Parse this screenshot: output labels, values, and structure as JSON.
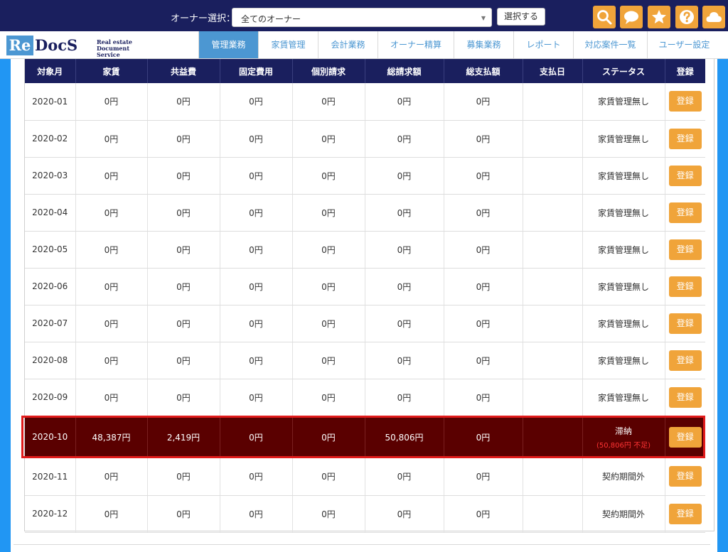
{
  "header": {
    "owner_label": "オーナー選択：",
    "owner_value": "全てのオーナー",
    "select_button": "選択する"
  },
  "logo": {
    "re": "Re",
    "docs": "DocS",
    "tag_line1": "Real estate",
    "tag_line2": "Document Service"
  },
  "nav": [
    {
      "label": "管理業務",
      "active": true
    },
    {
      "label": "家賃管理"
    },
    {
      "label": "会計業務"
    },
    {
      "label": "オーナー精算"
    },
    {
      "label": "募集業務"
    },
    {
      "label": "レポート"
    },
    {
      "label": "対応案件一覧"
    },
    {
      "label": "ユーザー設定"
    }
  ],
  "icons": [
    "search-icon",
    "chat-icon",
    "star-icon",
    "help-icon",
    "cloud-icon"
  ],
  "colors": {
    "header_bg": "#1a1f5e",
    "accent": "#4c97d2",
    "button": "#f0a43a",
    "highlight_bg": "#5a0000",
    "highlight_border": "#e11b1b"
  },
  "table": {
    "columns": [
      "対象月",
      "家賃",
      "共益費",
      "固定費用",
      "個別請求",
      "総請求額",
      "総支払額",
      "支払日",
      "ステータス",
      "登録"
    ],
    "rows": [
      {
        "month": "2020-01",
        "rent": "0円",
        "common": "0円",
        "fixed": "0円",
        "individual": "0円",
        "total_billed": "0円",
        "total_paid": "0円",
        "pay_date": "",
        "status": "家賃管理無し",
        "note": "",
        "button": "登録"
      },
      {
        "month": "2020-02",
        "rent": "0円",
        "common": "0円",
        "fixed": "0円",
        "individual": "0円",
        "total_billed": "0円",
        "total_paid": "0円",
        "pay_date": "",
        "status": "家賃管理無し",
        "note": "",
        "button": "登録"
      },
      {
        "month": "2020-03",
        "rent": "0円",
        "common": "0円",
        "fixed": "0円",
        "individual": "0円",
        "total_billed": "0円",
        "total_paid": "0円",
        "pay_date": "",
        "status": "家賃管理無し",
        "note": "",
        "button": "登録"
      },
      {
        "month": "2020-04",
        "rent": "0円",
        "common": "0円",
        "fixed": "0円",
        "individual": "0円",
        "total_billed": "0円",
        "total_paid": "0円",
        "pay_date": "",
        "status": "家賃管理無し",
        "note": "",
        "button": "登録"
      },
      {
        "month": "2020-05",
        "rent": "0円",
        "common": "0円",
        "fixed": "0円",
        "individual": "0円",
        "total_billed": "0円",
        "total_paid": "0円",
        "pay_date": "",
        "status": "家賃管理無し",
        "note": "",
        "button": "登録"
      },
      {
        "month": "2020-06",
        "rent": "0円",
        "common": "0円",
        "fixed": "0円",
        "individual": "0円",
        "total_billed": "0円",
        "total_paid": "0円",
        "pay_date": "",
        "status": "家賃管理無し",
        "note": "",
        "button": "登録"
      },
      {
        "month": "2020-07",
        "rent": "0円",
        "common": "0円",
        "fixed": "0円",
        "individual": "0円",
        "total_billed": "0円",
        "total_paid": "0円",
        "pay_date": "",
        "status": "家賃管理無し",
        "note": "",
        "button": "登録"
      },
      {
        "month": "2020-08",
        "rent": "0円",
        "common": "0円",
        "fixed": "0円",
        "individual": "0円",
        "total_billed": "0円",
        "total_paid": "0円",
        "pay_date": "",
        "status": "家賃管理無し",
        "note": "",
        "button": "登録"
      },
      {
        "month": "2020-09",
        "rent": "0円",
        "common": "0円",
        "fixed": "0円",
        "individual": "0円",
        "total_billed": "0円",
        "total_paid": "0円",
        "pay_date": "",
        "status": "家賃管理無し",
        "note": "",
        "button": "登録"
      },
      {
        "month": "2020-10",
        "rent": "48,387円",
        "common": "2,419円",
        "fixed": "0円",
        "individual": "0円",
        "total_billed": "50,806円",
        "total_paid": "0円",
        "pay_date": "",
        "status": "滞納",
        "note": "(50,806円 不足)",
        "button": "登録",
        "highlight": true
      },
      {
        "month": "2020-11",
        "rent": "0円",
        "common": "0円",
        "fixed": "0円",
        "individual": "0円",
        "total_billed": "0円",
        "total_paid": "0円",
        "pay_date": "",
        "status": "契約期間外",
        "note": "",
        "button": "登録"
      },
      {
        "month": "2020-12",
        "rent": "0円",
        "common": "0円",
        "fixed": "0円",
        "individual": "0円",
        "total_billed": "0円",
        "total_paid": "0円",
        "pay_date": "",
        "status": "契約期間外",
        "note": "",
        "button": "登録"
      }
    ]
  }
}
